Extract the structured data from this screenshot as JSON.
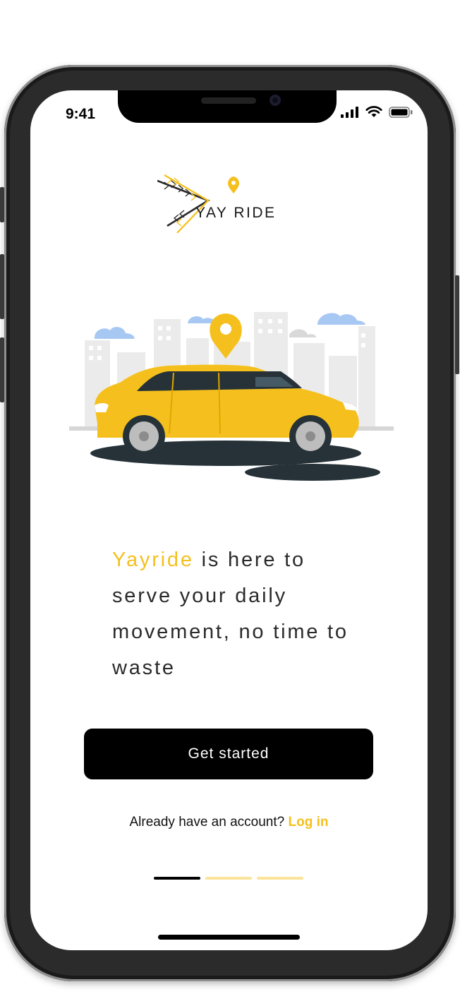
{
  "status_bar": {
    "time": "9:41"
  },
  "brand": {
    "logo_text": "YAY RIDE",
    "accent_color": "#f5c01d"
  },
  "hero": {
    "illustration": "yellow-car-city-illustration"
  },
  "headline": {
    "brand_word": "Yayride",
    "rest": " is here to serve your daily movement, no time to waste"
  },
  "cta": {
    "label": "Get started"
  },
  "login": {
    "prompt": "Already have an account? ",
    "link_label": "Log in"
  },
  "pager": {
    "pages": 3,
    "active_index": 0,
    "active_color": "#000000",
    "inactive_color": "#fbe39a"
  }
}
